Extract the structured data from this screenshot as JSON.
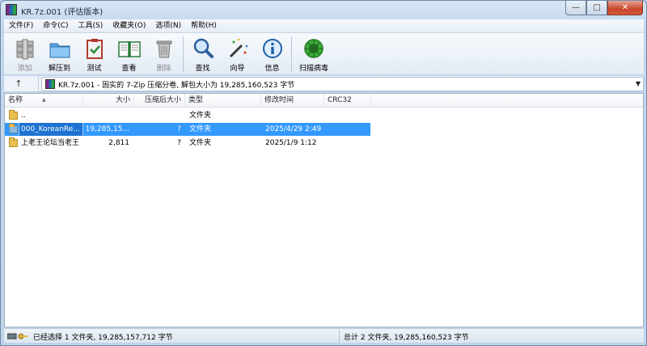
{
  "window": {
    "title": "KR.7z.001 (评估版本)"
  },
  "menu": [
    "文件(F)",
    "命令(C)",
    "工具(S)",
    "收藏夹(O)",
    "选项(N)",
    "帮助(H)"
  ],
  "toolbar": {
    "add": "添加",
    "extract_to": "解压到",
    "test": "测试",
    "view": "查看",
    "delete": "删除",
    "find": "查找",
    "wizard": "向导",
    "info": "信息",
    "virus_scan": "扫描病毒"
  },
  "address": {
    "text": "KR.7z.001 - 固实的 7-Zip 压缩分卷, 解包大小为 19,285,160,523 字节"
  },
  "columns": {
    "name": "名称",
    "size": "大小",
    "packed": "压缩后大小",
    "type": "类型",
    "modified": "修改时间",
    "crc": "CRC32"
  },
  "files": [
    {
      "name": "..",
      "size": "",
      "packed": "",
      "type": "文件夹",
      "modified": ""
    },
    {
      "name": "000_KoreanRe...",
      "size": "19,285,15...",
      "packed": "?",
      "type": "文件夹",
      "modified": "2025/4/29 2:49"
    },
    {
      "name": "上老王论坛当老王",
      "size": "2,811",
      "packed": "?",
      "type": "文件夹",
      "modified": "2025/1/9 1:12"
    }
  ],
  "status": {
    "left": "已经选择 1 文件夹, 19,285,157,712 字节",
    "right": "总计 2 文件夹, 19,285,160,523 字节"
  }
}
